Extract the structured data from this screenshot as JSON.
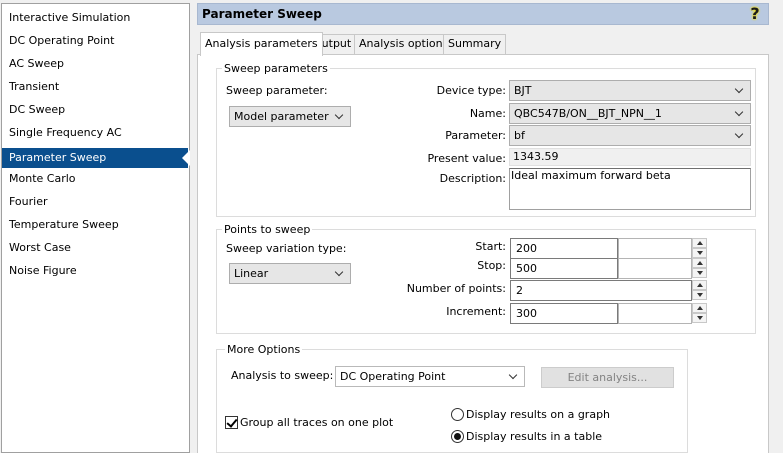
{
  "sidebar": {
    "items": [
      {
        "label": "Interactive Simulation"
      },
      {
        "label": "DC Operating Point"
      },
      {
        "label": "AC Sweep"
      },
      {
        "label": "Transient"
      },
      {
        "label": "DC Sweep"
      },
      {
        "label": "Single Frequency AC"
      },
      {
        "label": "Parameter Sweep"
      },
      {
        "label": "Monte Carlo"
      },
      {
        "label": "Fourier"
      },
      {
        "label": "Temperature Sweep"
      },
      {
        "label": "Worst Case"
      },
      {
        "label": "Noise Figure"
      }
    ],
    "selected": "Parameter Sweep"
  },
  "header": {
    "title": "Parameter Sweep",
    "help_glyph": "?"
  },
  "tabs": [
    {
      "label": "Analysis parameters"
    },
    {
      "label": "Output"
    },
    {
      "label": "Analysis options"
    },
    {
      "label": "Summary"
    }
  ],
  "sweep_params": {
    "group_label": "Sweep parameters",
    "sweep_parameter_label": "Sweep parameter:",
    "sweep_parameter_value": "Model parameter",
    "device_type_label": "Device type:",
    "device_type_value": "BJT",
    "name_label": "Name:",
    "name_value": "QBC547B/ON__BJT_NPN__1",
    "parameter_label": "Parameter:",
    "parameter_value": "bf",
    "present_value_label": "Present value:",
    "present_value": "1343.59",
    "description_label": "Description:",
    "description_value": "Ideal maximum forward beta"
  },
  "points": {
    "group_label": "Points to sweep",
    "variation_type_label": "Sweep variation type:",
    "variation_type_value": "Linear",
    "start_label": "Start:",
    "start_value": "200",
    "stop_label": "Stop:",
    "stop_value": "500",
    "num_points_label": "Number of points:",
    "num_points_value": "2",
    "increment_label": "Increment:",
    "increment_value": "300"
  },
  "more_options": {
    "group_label": "More Options",
    "analysis_to_sweep_label": "Analysis to sweep:",
    "analysis_to_sweep_value": "DC Operating Point",
    "edit_analysis_label": "Edit analysis...",
    "group_traces_label": "Group all traces on one plot",
    "group_traces_checked": true,
    "display_graph_label": "Display results on a graph",
    "display_table_label": "Display results in a table",
    "display_selected": "table"
  },
  "colors": {
    "selection": "#0a4f8e",
    "header_bg": "#b9c9e0"
  }
}
